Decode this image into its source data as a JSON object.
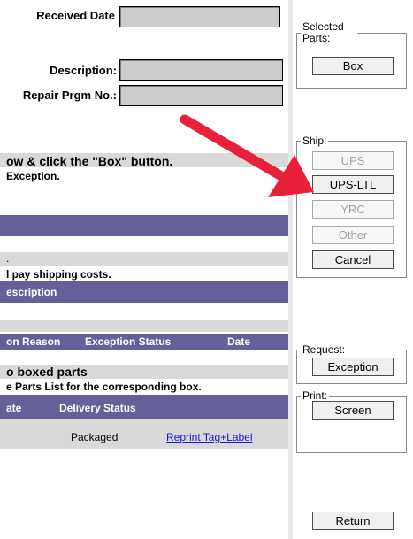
{
  "form": {
    "received_date_label": "Received Date",
    "received_date_value": "",
    "description_label": "Description:",
    "description_value": "",
    "repair_prgm_label": "Repair Prgm No.:",
    "repair_prgm_value": ""
  },
  "instructions": {
    "line1": "ow & click the \"Box\" button.",
    "line2": "Exception."
  },
  "shipping": {
    "dot": ".",
    "note": "l pay shipping costs.",
    "header": "escription"
  },
  "exceptions_table": {
    "columns": [
      "on Reason",
      "Exception Status",
      "Date"
    ]
  },
  "boxed": {
    "title": "o boxed parts",
    "subtitle": "e Parts List for the corresponding box.",
    "columns": [
      "ate",
      "Delivery Status"
    ],
    "rows": [
      {
        "status": "Packaged",
        "action": "Reprint Tag+Label"
      }
    ]
  },
  "side": {
    "selected_parts_legend": "Selected Parts:",
    "box_button": "Box",
    "ship_legend": "Ship:",
    "ship_buttons": [
      {
        "label": "UPS",
        "enabled": false
      },
      {
        "label": "UPS-LTL",
        "enabled": true
      },
      {
        "label": "YRC",
        "enabled": false
      },
      {
        "label": "Other",
        "enabled": false
      },
      {
        "label": "Cancel",
        "enabled": true
      }
    ],
    "request_legend": "Request:",
    "exception_button": "Exception",
    "print_legend": "Print:",
    "screen_button": "Screen",
    "return_button": "Return"
  },
  "colors": {
    "band_purple": "#66609a",
    "band_gray": "#d9d9d9",
    "arrow": "#e8203a",
    "link": "#1a1ad8"
  }
}
